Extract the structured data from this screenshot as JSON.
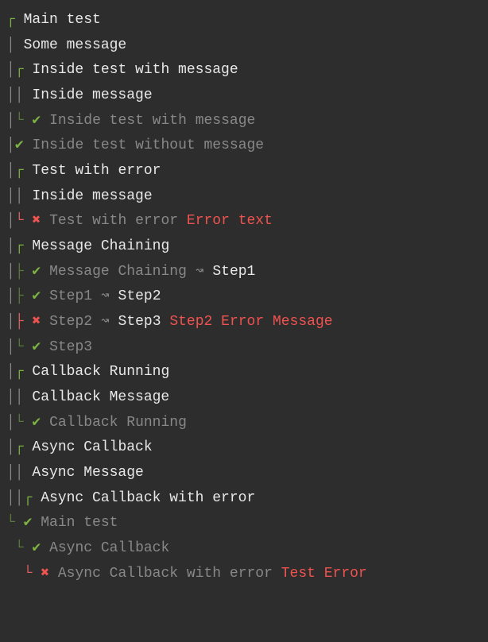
{
  "lines": [
    {
      "segments": [
        {
          "cls": "tree",
          "text": "┌ "
        },
        {
          "cls": "text-white",
          "text": "Main test"
        }
      ]
    },
    {
      "segments": [
        {
          "cls": "pipe",
          "text": "│ "
        },
        {
          "cls": "text-white",
          "text": "Some message"
        }
      ]
    },
    {
      "segments": [
        {
          "cls": "pipe",
          "text": "│"
        },
        {
          "cls": "tree",
          "text": "┌ "
        },
        {
          "cls": "text-white",
          "text": "Inside test with message"
        }
      ]
    },
    {
      "segments": [
        {
          "cls": "pipe",
          "text": "││ "
        },
        {
          "cls": "text-white",
          "text": "Inside message"
        }
      ]
    },
    {
      "segments": [
        {
          "cls": "pipe",
          "text": "│"
        },
        {
          "cls": "tree-dim",
          "text": "└ "
        },
        {
          "cls": "check",
          "text": "✔ "
        },
        {
          "cls": "text-dim",
          "text": "Inside test with message"
        }
      ]
    },
    {
      "segments": [
        {
          "cls": "pipe",
          "text": "│"
        },
        {
          "cls": "check",
          "text": "✔ "
        },
        {
          "cls": "text-dim",
          "text": "Inside test without message"
        }
      ]
    },
    {
      "segments": [
        {
          "cls": "pipe",
          "text": "│"
        },
        {
          "cls": "tree",
          "text": "┌ "
        },
        {
          "cls": "text-white",
          "text": "Test with error"
        }
      ]
    },
    {
      "segments": [
        {
          "cls": "pipe",
          "text": "││ "
        },
        {
          "cls": "text-white",
          "text": "Inside message"
        }
      ]
    },
    {
      "segments": [
        {
          "cls": "pipe",
          "text": "│"
        },
        {
          "cls": "tree-red",
          "text": "└ "
        },
        {
          "cls": "cross",
          "text": "✖ "
        },
        {
          "cls": "text-dim",
          "text": "Test with error "
        },
        {
          "cls": "text-error",
          "text": "Error text"
        }
      ]
    },
    {
      "segments": [
        {
          "cls": "pipe",
          "text": "│"
        },
        {
          "cls": "tree",
          "text": "┌ "
        },
        {
          "cls": "text-white",
          "text": "Message Chaining"
        }
      ]
    },
    {
      "segments": [
        {
          "cls": "pipe",
          "text": "│"
        },
        {
          "cls": "tree-dim",
          "text": "├ "
        },
        {
          "cls": "check",
          "text": "✔ "
        },
        {
          "cls": "text-dim",
          "text": "Message Chaining "
        },
        {
          "cls": "arrow",
          "text": "↝ "
        },
        {
          "cls": "text-white",
          "text": "Step1"
        }
      ]
    },
    {
      "segments": [
        {
          "cls": "pipe",
          "text": "│"
        },
        {
          "cls": "tree-dim",
          "text": "├ "
        },
        {
          "cls": "check",
          "text": "✔ "
        },
        {
          "cls": "text-dim",
          "text": "Step1 "
        },
        {
          "cls": "arrow",
          "text": "↝ "
        },
        {
          "cls": "text-white",
          "text": "Step2"
        }
      ]
    },
    {
      "segments": [
        {
          "cls": "pipe",
          "text": "│"
        },
        {
          "cls": "tree-red",
          "text": "├ "
        },
        {
          "cls": "cross",
          "text": "✖ "
        },
        {
          "cls": "text-dim",
          "text": "Step2 "
        },
        {
          "cls": "arrow",
          "text": "↝ "
        },
        {
          "cls": "text-white",
          "text": "Step3 "
        },
        {
          "cls": "text-error",
          "text": "Step2 Error Message"
        }
      ]
    },
    {
      "segments": [
        {
          "cls": "pipe",
          "text": "│"
        },
        {
          "cls": "tree-dim",
          "text": "└ "
        },
        {
          "cls": "check",
          "text": "✔ "
        },
        {
          "cls": "text-dim",
          "text": "Step3"
        }
      ]
    },
    {
      "segments": [
        {
          "cls": "pipe",
          "text": "│"
        },
        {
          "cls": "tree",
          "text": "┌ "
        },
        {
          "cls": "text-white",
          "text": "Callback Running"
        }
      ]
    },
    {
      "segments": [
        {
          "cls": "pipe",
          "text": "││ "
        },
        {
          "cls": "text-white",
          "text": "Callback Message"
        }
      ]
    },
    {
      "segments": [
        {
          "cls": "pipe",
          "text": "│"
        },
        {
          "cls": "tree-dim",
          "text": "└ "
        },
        {
          "cls": "check",
          "text": "✔ "
        },
        {
          "cls": "text-dim",
          "text": "Callback Running"
        }
      ]
    },
    {
      "segments": [
        {
          "cls": "pipe",
          "text": "│"
        },
        {
          "cls": "tree",
          "text": "┌ "
        },
        {
          "cls": "text-white",
          "text": "Async Callback"
        }
      ]
    },
    {
      "segments": [
        {
          "cls": "pipe",
          "text": "││ "
        },
        {
          "cls": "text-white",
          "text": "Async Message"
        }
      ]
    },
    {
      "segments": [
        {
          "cls": "pipe",
          "text": "││"
        },
        {
          "cls": "tree",
          "text": "┌ "
        },
        {
          "cls": "text-white",
          "text": "Async Callback with error"
        }
      ]
    },
    {
      "segments": [
        {
          "cls": "tree-dim",
          "text": "└ "
        },
        {
          "cls": "check",
          "text": "✔ "
        },
        {
          "cls": "text-dim",
          "text": "Main test"
        }
      ]
    },
    {
      "segments": [
        {
          "cls": "pipe",
          "text": " "
        },
        {
          "cls": "tree-dim",
          "text": "└ "
        },
        {
          "cls": "check",
          "text": "✔ "
        },
        {
          "cls": "text-dim",
          "text": "Async Callback"
        }
      ]
    },
    {
      "segments": [
        {
          "cls": "pipe",
          "text": "  "
        },
        {
          "cls": "tree-red",
          "text": "└ "
        },
        {
          "cls": "cross",
          "text": "✖ "
        },
        {
          "cls": "text-dim",
          "text": "Async Callback with error "
        },
        {
          "cls": "text-error",
          "text": "Test Error"
        }
      ]
    }
  ]
}
